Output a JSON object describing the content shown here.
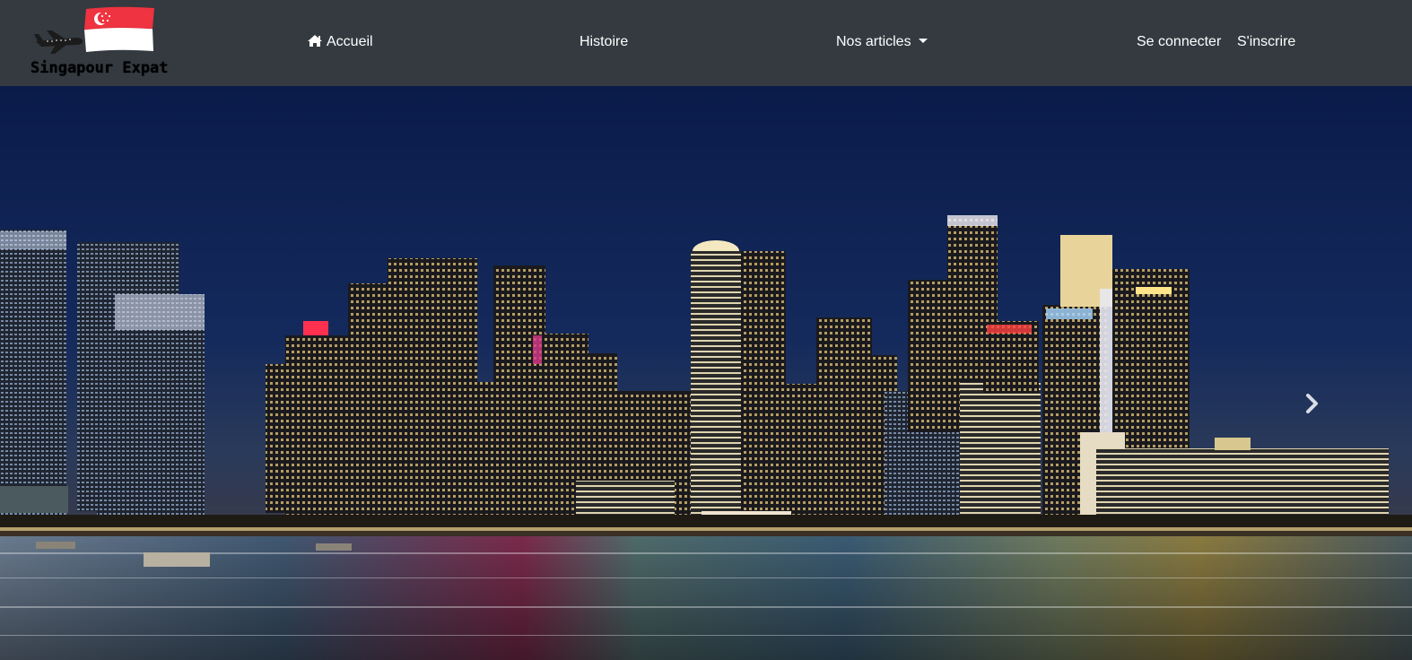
{
  "brand": {
    "name": "Singapour Expat",
    "icons": [
      "airplane-icon",
      "singapore-flag-icon"
    ]
  },
  "nav": {
    "home": {
      "label": "Accueil",
      "icon": "home-icon"
    },
    "history": {
      "label": "Histoire"
    },
    "articles": {
      "label": "Nos articles",
      "icon": "caret-down-icon"
    },
    "login": {
      "label": "Se connecter"
    },
    "signup": {
      "label": "S'inscrire"
    }
  },
  "carousel": {
    "slide_description": "Singapore skyline at night",
    "next_icon": "chevron-right-icon"
  },
  "colors": {
    "navbar_bg": "#343a40",
    "nav_text": "#ffffff",
    "sky_top": "#0a1b4a",
    "sky_bottom": "#22365c",
    "flag_red": "#ef3340",
    "flag_white": "#ffffff"
  }
}
